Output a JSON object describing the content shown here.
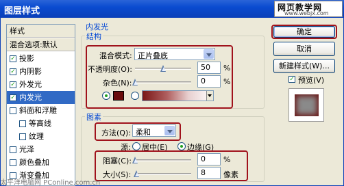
{
  "window": {
    "title": "图层样式",
    "watermark_line1": "网页教学网",
    "watermark_line2": "www.webjx.com"
  },
  "sidebar": {
    "header_styles": "样式",
    "header_blend": "混合选项:默认",
    "items": [
      {
        "label": "投影",
        "checked": true
      },
      {
        "label": "内阴影",
        "checked": true
      },
      {
        "label": "外发光",
        "checked": true
      },
      {
        "label": "内发光",
        "checked": true,
        "selected": true
      },
      {
        "label": "斜面和浮雕",
        "checked": false
      },
      {
        "label": "等高线",
        "checked": false
      },
      {
        "label": "纹理",
        "checked": false
      },
      {
        "label": "光泽",
        "checked": false
      },
      {
        "label": "颜色叠加",
        "checked": false
      },
      {
        "label": "渐变叠加",
        "checked": false
      }
    ]
  },
  "inner_glow": {
    "section_title": "内发光",
    "structure_title": "结构",
    "blend_mode_label": "混合模式:",
    "blend_mode_value": "正片叠底",
    "opacity_label": "不透明度(O):",
    "opacity_value": "50",
    "opacity_unit": "%",
    "opacity_level": 0.5,
    "noise_label": "杂色(N):",
    "noise_value": "0",
    "noise_unit": "%",
    "noise_level": 0,
    "glow_color": "#6a0b0b",
    "elements_title": "图素",
    "method_label": "方法(Q):",
    "method_value": "柔和",
    "source_label": "源:",
    "source_center": "居中(E)",
    "source_edge": "边缘(G)",
    "source_selected": "edge",
    "choke_label": "阻塞(C):",
    "choke_value": "0",
    "choke_unit": "%",
    "choke_level": 0,
    "size_label": "大小(S):",
    "size_value": "8",
    "size_unit": "像素",
    "size_level": 0.03
  },
  "buttons": {
    "ok": "确定",
    "cancel": "取消",
    "new_style": "新建样式(W)...",
    "preview_label": "预览(V)",
    "preview_checked": true
  },
  "footer": {
    "watermark": "太平洋电脑网 PConline.com.cn"
  },
  "colors": {
    "accent": "#316ac5",
    "highlight_border": "#a0121c",
    "titlebar": "#0a4bd0"
  }
}
